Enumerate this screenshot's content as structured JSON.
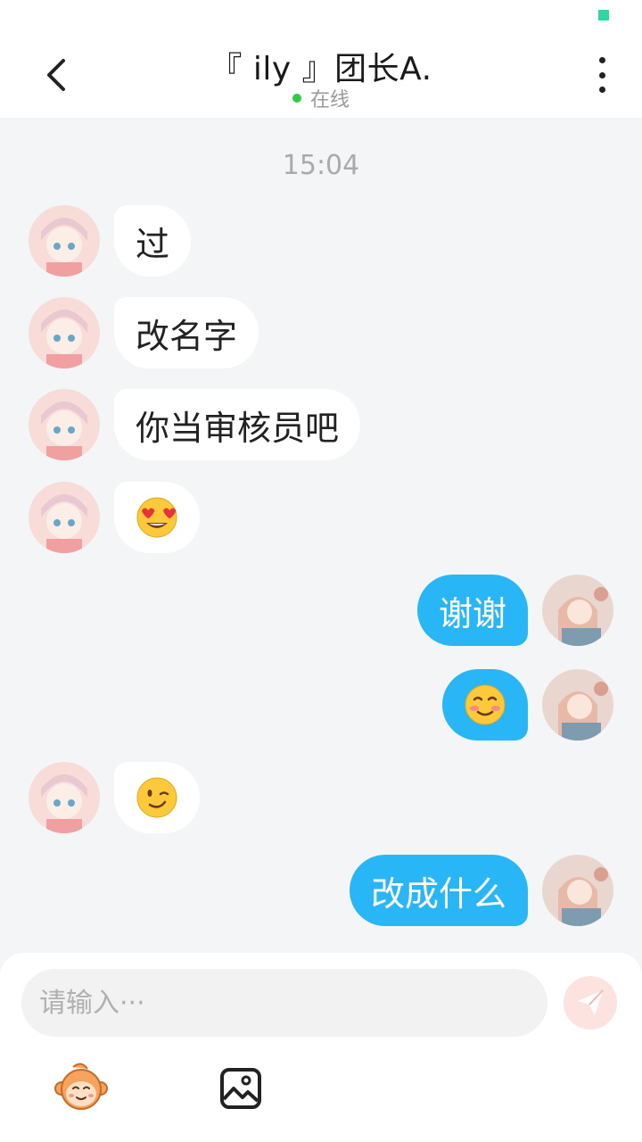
{
  "header": {
    "title": "『 ily 』团长A.",
    "status": "在线"
  },
  "chat": {
    "time": "15:04",
    "messages": [
      {
        "side": "in",
        "text": "过"
      },
      {
        "side": "in",
        "text": "改名字"
      },
      {
        "side": "in",
        "text": "你当审核员吧"
      },
      {
        "side": "in",
        "emoji": "heart-eyes"
      },
      {
        "side": "out",
        "text": "谢谢"
      },
      {
        "side": "out",
        "emoji": "blush"
      },
      {
        "side": "in",
        "emoji": "wink"
      },
      {
        "side": "out",
        "text": "改成什么"
      }
    ]
  },
  "input": {
    "placeholder": "请输入···"
  },
  "colors": {
    "accent": "#29b6f6",
    "online": "#2ecc40",
    "background": "#f4f5f7",
    "send_button_bg": "#fde3e0"
  }
}
